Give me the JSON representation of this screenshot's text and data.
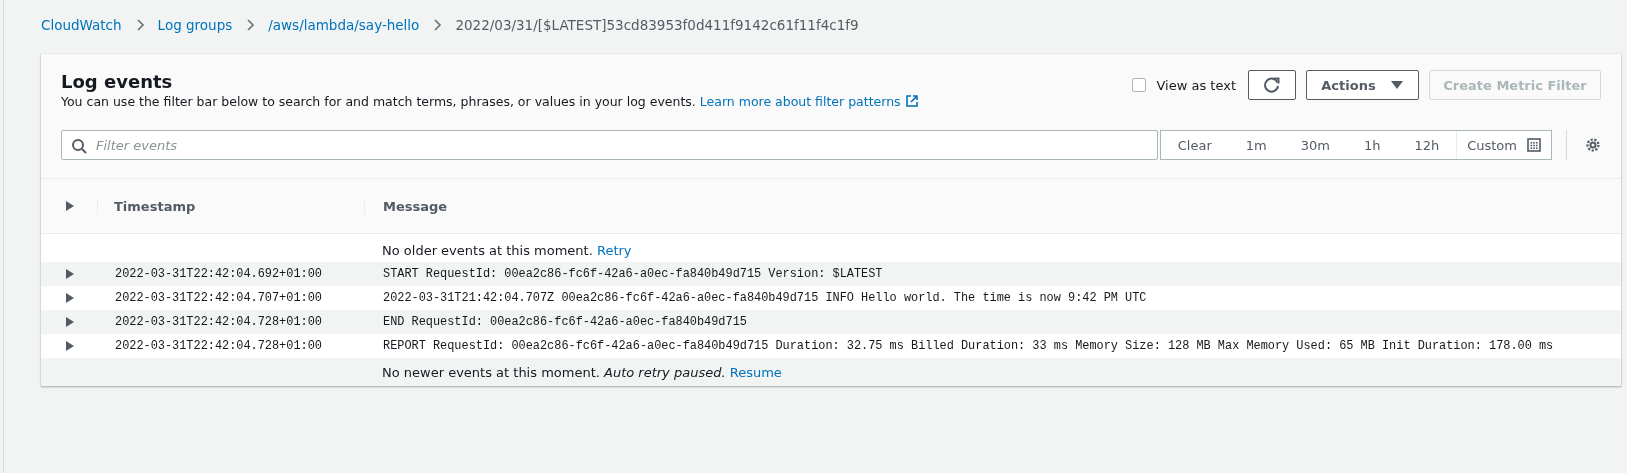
{
  "breadcrumbs": [
    {
      "label": "CloudWatch",
      "link": true
    },
    {
      "label": "Log groups",
      "link": true
    },
    {
      "label": "/aws/lambda/say-hello",
      "link": true
    },
    {
      "label": "2022/03/31/[$LATEST]53cd83953f0d411f9142c61f11f4c1f9",
      "link": false
    }
  ],
  "panel": {
    "title": "Log events",
    "description": "You can use the filter bar below to search for and match terms, phrases, or values in your log events.",
    "help_link": "Learn more about filter patterns",
    "view_as_text": {
      "label": "View as text",
      "checked": false
    },
    "actions_button": "Actions",
    "create_button": {
      "label": "Create Metric Filter",
      "disabled": true
    }
  },
  "filter": {
    "placeholder": "Filter events",
    "ranges": [
      "Clear",
      "1m",
      "30m",
      "1h",
      "12h"
    ],
    "custom": "Custom"
  },
  "table": {
    "columns": [
      "Timestamp",
      "Message"
    ],
    "top_notice": {
      "text": "No older events at this moment.",
      "link": "Retry"
    },
    "rows": [
      {
        "timestamp": "2022-03-31T22:42:04.692+01:00",
        "message": "START RequestId: 00ea2c86-fc6f-42a6-a0ec-fa840b49d715 Version: $LATEST"
      },
      {
        "timestamp": "2022-03-31T22:42:04.707+01:00",
        "message": "2022-03-31T21:42:04.707Z 00ea2c86-fc6f-42a6-a0ec-fa840b49d715 INFO Hello world. The time is now 9:42 PM UTC"
      },
      {
        "timestamp": "2022-03-31T22:42:04.728+01:00",
        "message": "END RequestId: 00ea2c86-fc6f-42a6-a0ec-fa840b49d715"
      },
      {
        "timestamp": "2022-03-31T22:42:04.728+01:00",
        "message": "REPORT RequestId: 00ea2c86-fc6f-42a6-a0ec-fa840b49d715 Duration: 32.75 ms Billed Duration: 33 ms Memory Size: 128 MB Max Memory Used: 65 MB Init Duration: 178.00 ms"
      }
    ],
    "bottom_notice": {
      "text": "No newer events at this moment.",
      "note": "Auto retry paused.",
      "link": "Resume"
    }
  }
}
